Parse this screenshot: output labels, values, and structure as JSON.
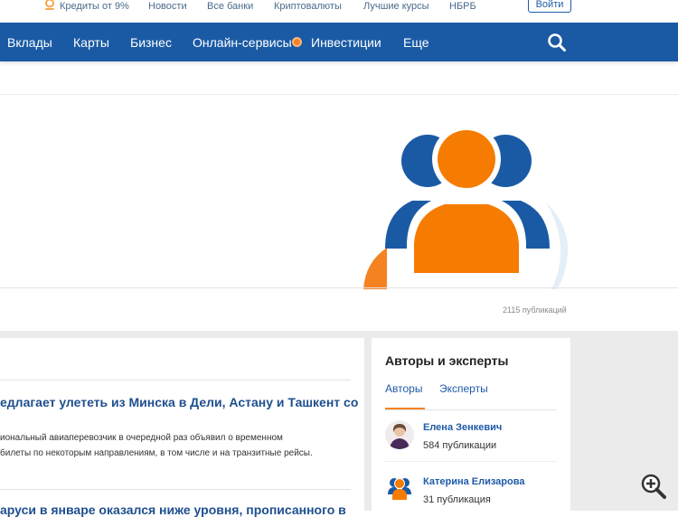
{
  "topbar": {
    "links": [
      "Кредиты от 9%",
      "Новости",
      "Все банки",
      "Криптовалюты",
      "Лучшие курсы",
      "НБРБ"
    ],
    "login_label": "Войти"
  },
  "nav": {
    "items": [
      "Вклады",
      "Карты",
      "Бизнес",
      "Онлайн-сервисы",
      "Инвестиции",
      "Еще"
    ]
  },
  "hero": {
    "publications": "2115 публикаций"
  },
  "articles": [
    {
      "title": "едлагает улететь из Минска в Дели, Астану и Ташкент со",
      "text": [
        "иональный авиаперевозчик в очередной раз объявил о временном",
        "билеты по некоторым направлениям, в том числе и на транзитные рейсы."
      ]
    },
    {
      "title": "аруси в январе оказался ниже уровня, прописанного в"
    }
  ],
  "sidebar": {
    "title": "Авторы и эксперты",
    "tabs": [
      "Авторы",
      "Эксперты"
    ],
    "authors": [
      {
        "name": "Елена Зенкевич",
        "pubs": "584 публикации"
      },
      {
        "name": "Катерина Елизарова",
        "pubs": "31 публикация"
      }
    ]
  },
  "colors": {
    "brand_blue": "#1a5aa5",
    "accent_orange": "#f58220"
  }
}
